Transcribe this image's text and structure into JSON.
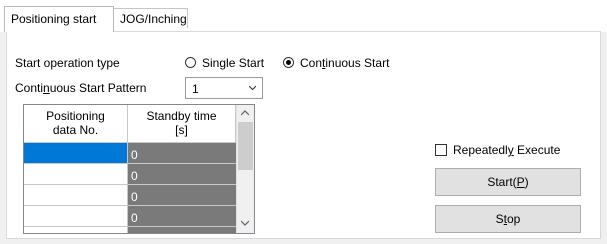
{
  "tabs": [
    {
      "label": "Positioning start",
      "active": true
    },
    {
      "label": "JOG/Inching",
      "active": false
    }
  ],
  "start_operation": {
    "label": "Start operation type",
    "options": [
      {
        "label_pre": "Sin",
        "label_acc": "g",
        "label_post": "le Start",
        "selected": false
      },
      {
        "label_pre": "Con",
        "label_acc": "t",
        "label_post": "inuous Start",
        "selected": true
      }
    ]
  },
  "pattern": {
    "label_pre": "Conti",
    "label_acc": "n",
    "label_post": "uous Start Pattern",
    "value": "1"
  },
  "grid": {
    "columns": [
      "Positioning\ndata No.",
      "Standby time\n[s]"
    ],
    "col1_line1": "Positioning",
    "col1_line2": "data No.",
    "col2_line1": "Standby time",
    "col2_line2": "[s]",
    "rows": [
      {
        "no": "",
        "standby": "0",
        "selected": true
      },
      {
        "no": "",
        "standby": "0",
        "selected": false
      },
      {
        "no": "",
        "standby": "0",
        "selected": false
      },
      {
        "no": "",
        "standby": "0",
        "selected": false
      },
      {
        "no": "",
        "standby": "",
        "selected": false
      }
    ]
  },
  "repeat": {
    "label_pre": "Repeatedl",
    "label_acc": "y",
    "label_post": " Execute",
    "checked": false
  },
  "buttons": {
    "start_pre": "Start(",
    "start_acc": "P",
    "start_post": ")",
    "stop_pre": "S",
    "stop_acc": "t",
    "stop_post": "op"
  },
  "colors": {
    "selection": "#0078d7",
    "readonly_cell": "#7a7a7a"
  }
}
